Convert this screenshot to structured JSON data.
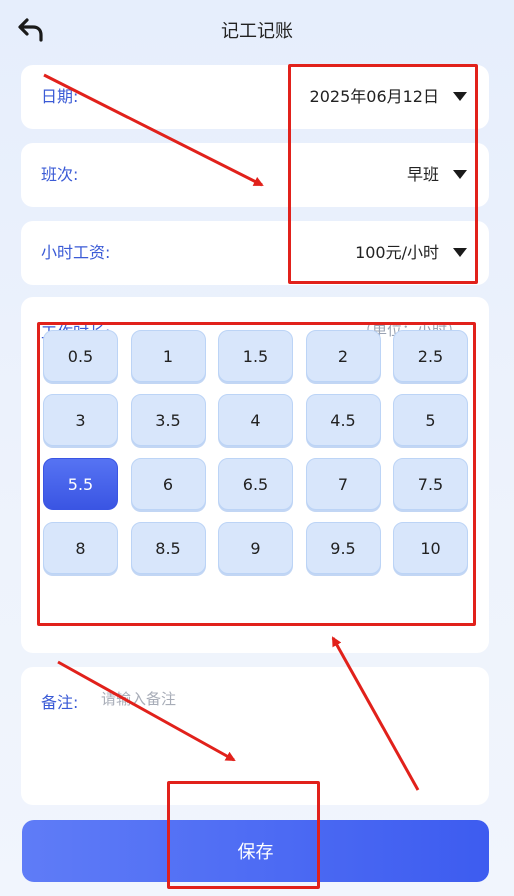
{
  "header": {
    "title": "记工记账",
    "back_icon": "back-arrow-icon"
  },
  "date": {
    "label": "日期:",
    "value": "2025年06月12日"
  },
  "shift": {
    "label": "班次:",
    "value": "早班"
  },
  "wage": {
    "label": "小时工资:",
    "value": "100元/小时"
  },
  "hours": {
    "title": "工作时长:",
    "unit": "（单位：小时）",
    "selected": "5.5",
    "options": [
      "0.5",
      "1",
      "1.5",
      "2",
      "2.5",
      "3",
      "3.5",
      "4",
      "4.5",
      "5",
      "5.5",
      "6",
      "6.5",
      "7",
      "7.5",
      "8",
      "8.5",
      "9",
      "9.5",
      "10"
    ]
  },
  "note": {
    "label": "备注:",
    "placeholder": "请输入备注",
    "value": ""
  },
  "save": {
    "label": "保存"
  },
  "colors": {
    "accent": "#3d5cf0",
    "label": "#3b5bd6",
    "annotation": "#e1211b"
  }
}
